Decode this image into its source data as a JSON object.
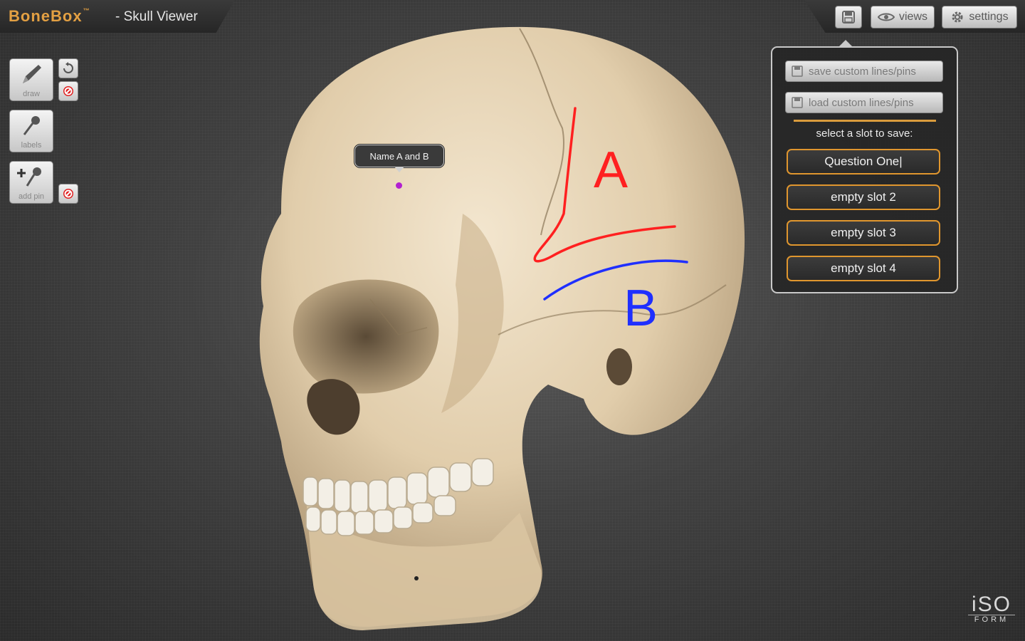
{
  "app": {
    "brand": "BoneBox",
    "brand_mark": "™",
    "subtitle": "- Skull Viewer"
  },
  "toolbar": {
    "views_label": "views",
    "settings_label": "settings",
    "save_icon": "save-slot-icon",
    "views_icon": "eye-icon",
    "settings_icon": "gear-icon"
  },
  "tools": {
    "draw_label": "draw",
    "labels_label": "labels",
    "add_pin_label": "add pin"
  },
  "popover": {
    "save_label": "save custom lines/pins",
    "load_label": "load custom lines/pins",
    "caption": "select a slot to save:",
    "slots": [
      "Question One|",
      "empty slot 2",
      "empty slot 3",
      "empty slot 4"
    ]
  },
  "canvas": {
    "pin_tooltip": "Name A and B",
    "annotation_a": "A",
    "annotation_b": "B",
    "colors": {
      "red": "#ff2020",
      "blue": "#1f2fff",
      "accent": "#e0962e",
      "pin": "#b21fd0"
    }
  },
  "logo": {
    "top": "iSO",
    "bottom": "FORM"
  }
}
